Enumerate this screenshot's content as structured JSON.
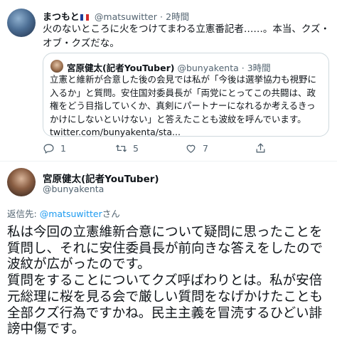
{
  "top_tweet": {
    "name": "まつもと",
    "handle": "@matsuwitter",
    "separator": "·",
    "time": "2時間",
    "text": "火のないところに火をつけてまわる立憲番記者……。本当、クズ・オブ・クズだな。",
    "quote": {
      "name": "宮原健太(記者YouTuber)",
      "handle": "@bunyakenta",
      "separator": "·",
      "time": "3時間",
      "text": "立憲と維新が合意した後の会見では私が「今後は選挙協力も視野に入るか」と質問。安住国対委員長が「両党にとってこの共闘は、政権をどう目指していくか、真剣にパートナーになれるか考えるきっかけにしないといけない」と答えたことも波紋を呼んでいます。",
      "link": "twitter.com/bunyakenta/sta..."
    },
    "actions": {
      "reply_count": "1",
      "retweet_count": "5",
      "like_count": "7"
    }
  },
  "main_tweet": {
    "name": "宮原健太(記者YouTuber)",
    "handle": "@bunyakenta",
    "reply_label": "返信先:",
    "reply_handle": "@matsuwitter",
    "reply_suffix": "さん",
    "text": "私は今回の立憲維新合意について疑問に思ったことを質問し、それに安住委員長が前向きな答えをしたので波紋が広がったのです。\n質問をすることについてクズ呼ばわりとは。私が安倍元総理に桜を見る会で厳しい質問をなげかけたことも全部クズ行為ですかね。民主主義を冒涜するひどい誹謗中傷です。"
  }
}
